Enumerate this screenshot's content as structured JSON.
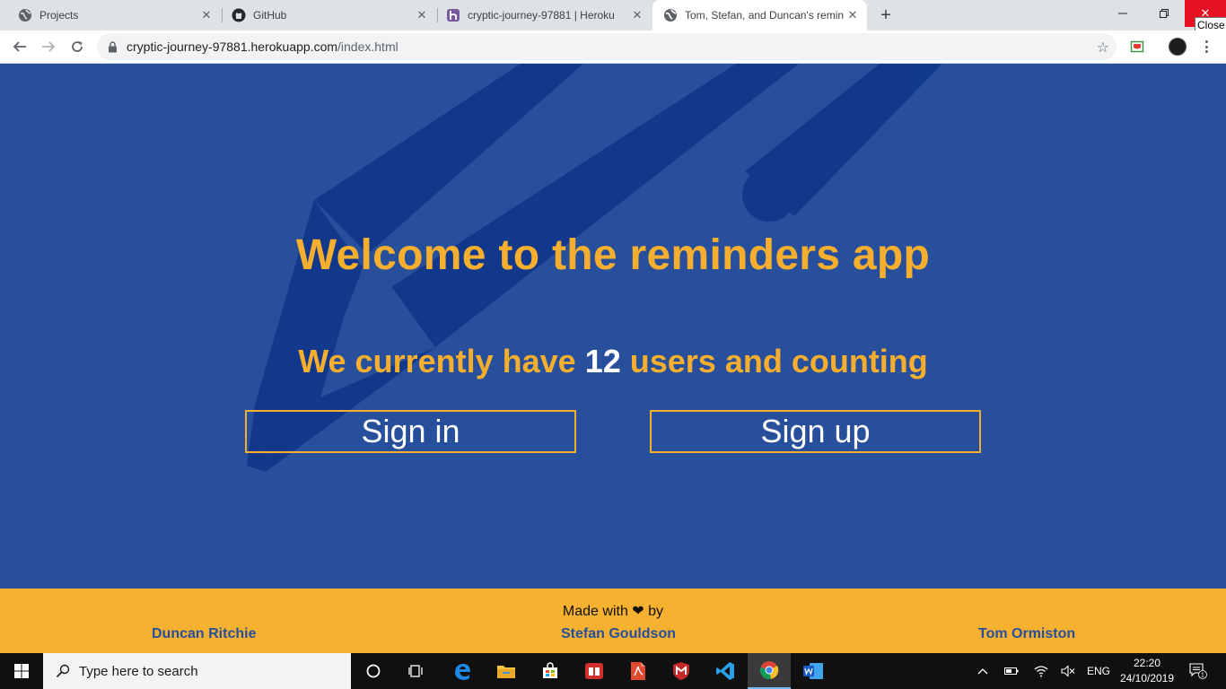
{
  "tabs": [
    {
      "title": "Projects",
      "favicon": "globe-icon"
    },
    {
      "title": "GitHub",
      "favicon": "github-icon"
    },
    {
      "title": "cryptic-journey-97881 | Heroku",
      "favicon": "heroku-icon"
    },
    {
      "title": "Tom, Stefan, and Duncan's remin",
      "favicon": "globe-icon",
      "active": true
    }
  ],
  "window": {
    "close_tooltip": "Close"
  },
  "address_bar": {
    "domain": "cryptic-journey-97881.herokuapp.com",
    "path": "/index.html"
  },
  "page": {
    "title": "Welcome to the reminders app",
    "subtitle_before": "We currently have",
    "user_count": "12",
    "subtitle_after": "users and counting",
    "signin_label": "Sign in",
    "signup_label": "Sign up"
  },
  "footer": {
    "made_with": "Made with",
    "by": "by",
    "authors": [
      "Duncan Ritchie",
      "Stefan Gouldson",
      "Tom Ormiston"
    ]
  },
  "taskbar": {
    "search_placeholder": "Type here to search",
    "language": "ENG",
    "time": "22:20",
    "date": "24/10/2019",
    "notification_count": "1"
  },
  "colors": {
    "page_bg": "#284f9c",
    "accent": "#f5ae2d",
    "footer_bg": "#f5b12f",
    "pencil": "#0d3589"
  }
}
